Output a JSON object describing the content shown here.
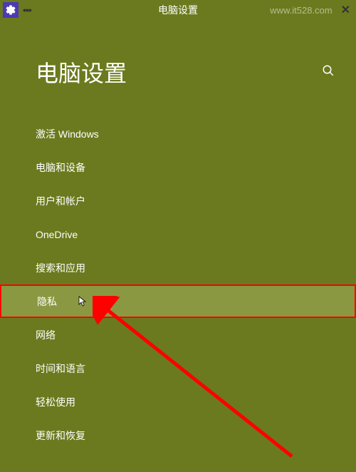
{
  "titlebar": {
    "title": "电脑设置",
    "more_label": "•••",
    "watermark": "www.it528.com"
  },
  "header": {
    "page_title": "电脑设置"
  },
  "menu": {
    "items": [
      {
        "label": "激活 Windows",
        "highlighted": false
      },
      {
        "label": "电脑和设备",
        "highlighted": false
      },
      {
        "label": "用户和帐户",
        "highlighted": false
      },
      {
        "label": "OneDrive",
        "highlighted": false
      },
      {
        "label": "搜索和应用",
        "highlighted": false
      },
      {
        "label": "隐私",
        "highlighted": true
      },
      {
        "label": "网络",
        "highlighted": false
      },
      {
        "label": "时间和语言",
        "highlighted": false
      },
      {
        "label": "轻松使用",
        "highlighted": false
      },
      {
        "label": "更新和恢复",
        "highlighted": false
      }
    ]
  },
  "colors": {
    "background": "#6b7a1e",
    "highlight_bg": "#8a9842",
    "highlight_border": "#ff0000",
    "gear_bg": "#4b3ab3",
    "arrow": "#ff0000"
  }
}
